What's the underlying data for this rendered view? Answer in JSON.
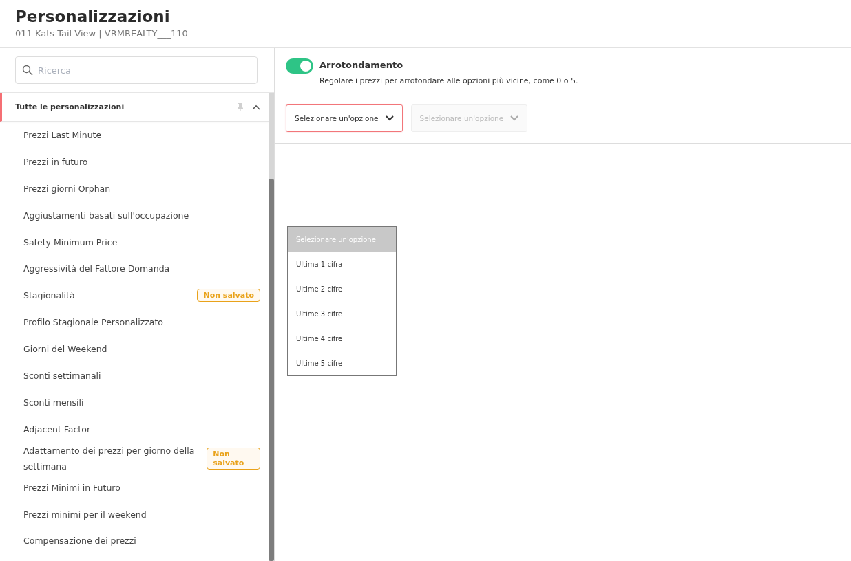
{
  "header": {
    "title": "Personalizzazioni",
    "subtitle": "011 Kats Tail View | VRMREALTY___110"
  },
  "sidebar": {
    "search": {
      "placeholder": "Ricerca"
    },
    "section": {
      "title": "Tutte le personalizzazioni",
      "expanded": true
    },
    "items": [
      {
        "label": "Prezzi Last Minute"
      },
      {
        "label": "Prezzi in futuro"
      },
      {
        "label": "Prezzi giorni Orphan"
      },
      {
        "label": "Aggiustamenti basati sull'occupazione"
      },
      {
        "label": "Safety Minimum Price"
      },
      {
        "label": "Aggressività del Fattore Domanda"
      },
      {
        "label": "Stagionalità",
        "badge": "Non salvato"
      },
      {
        "label": "Profilo Stagionale Personalizzato"
      },
      {
        "label": "Giorni del Weekend"
      },
      {
        "label": "Sconti settimanali"
      },
      {
        "label": "Sconti mensili"
      },
      {
        "label": "Adjacent Factor"
      },
      {
        "label": "Adattamento dei prezzi per giorno della settimana",
        "badge": "Non salvato"
      },
      {
        "label": "Prezzi Minimi in Futuro"
      },
      {
        "label": "Prezzi minimi per il weekend"
      },
      {
        "label": "Compensazione dei prezzi"
      }
    ]
  },
  "setting": {
    "title": "Arrotondamento",
    "on": true,
    "description": "Regolare i prezzi per arrotondare alle opzioni più vicine, come 0 o 5.",
    "selects": [
      {
        "value": "Selezionare un'opzione",
        "error": true,
        "disabled": false
      },
      {
        "value": "Selezionare un'opzione",
        "error": false,
        "disabled": true
      }
    ]
  },
  "dropdown": {
    "options": [
      {
        "label": "Selezionare un'opzione",
        "selected": true
      },
      {
        "label": "Ultima 1 cifra",
        "selected": false
      },
      {
        "label": "Ultime 2 cifre",
        "selected": false
      },
      {
        "label": "Ultime 3 cifre",
        "selected": false
      },
      {
        "label": "Ultime 4 cifre",
        "selected": false
      },
      {
        "label": "Ultime 5 cifre",
        "selected": false
      }
    ]
  }
}
